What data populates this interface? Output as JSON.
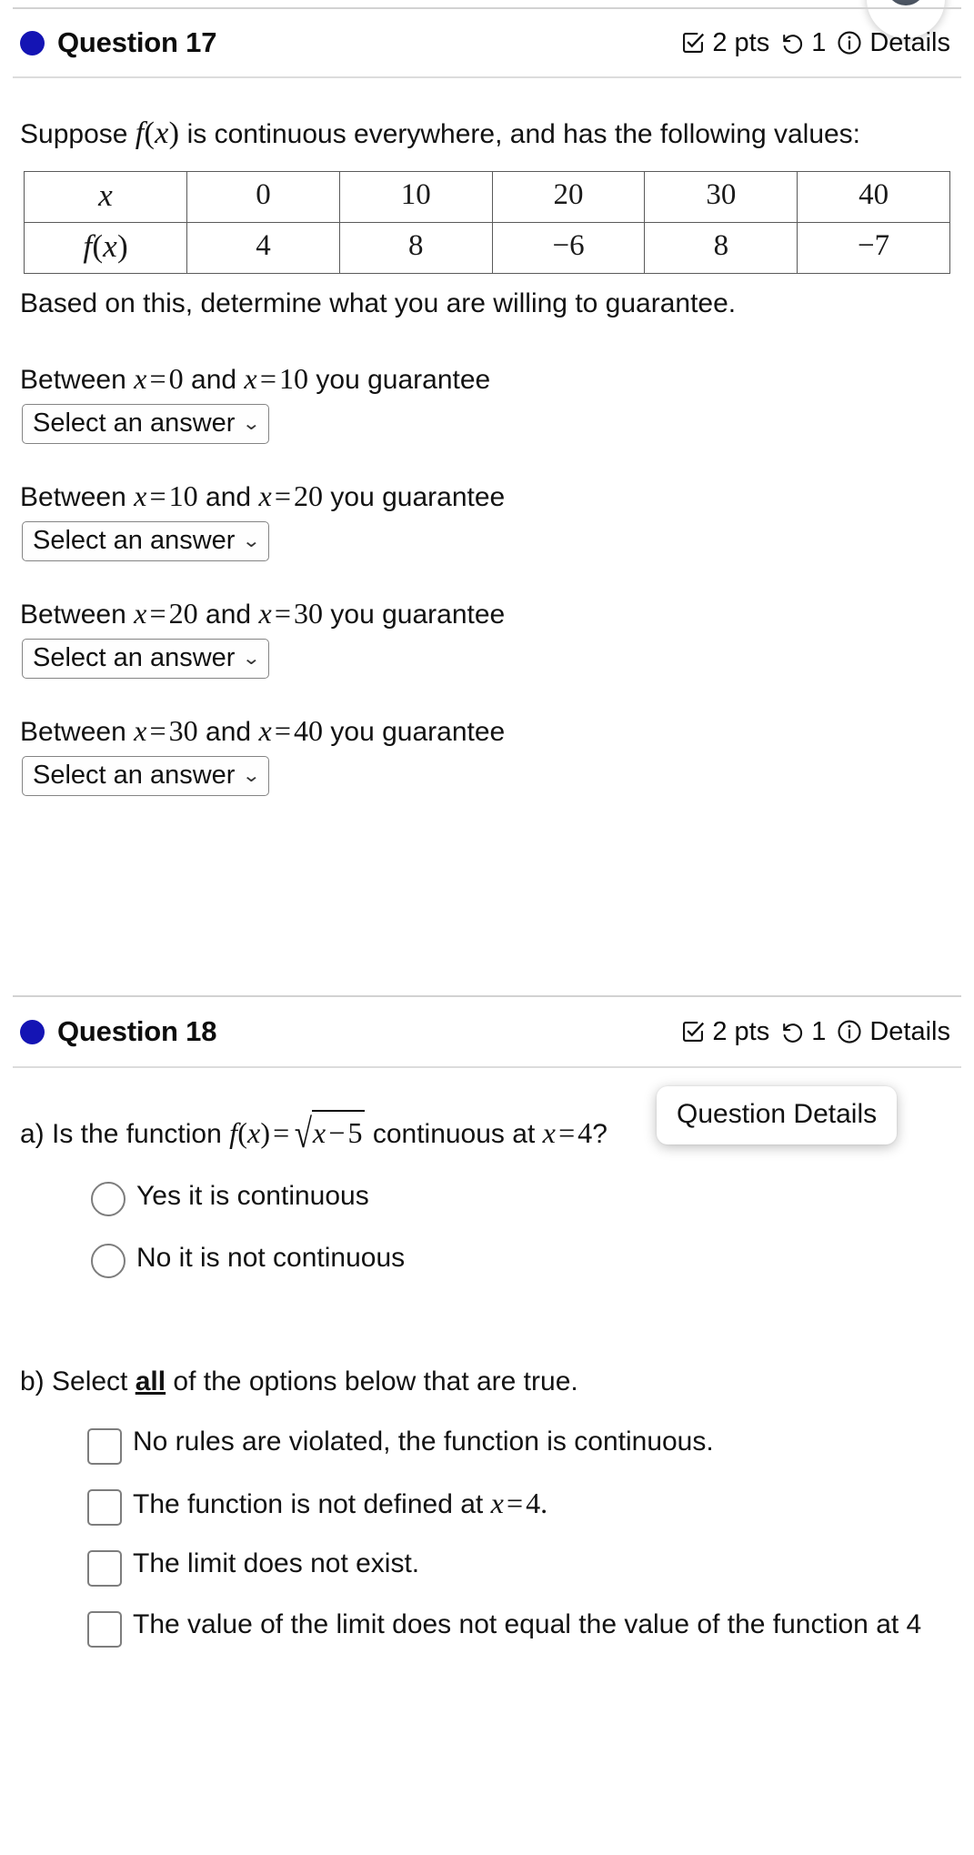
{
  "colors": {
    "question_dot": "#1414b4",
    "rule": "#d7d7d7",
    "control_border": "#848484"
  },
  "questions": [
    {
      "id": "q17",
      "dot_icon": "filled-circle-icon",
      "title": "Question 17",
      "meta": {
        "points_icon": "checkbox-check-icon",
        "points": "2 pts",
        "attempts_icon": "undo-arrow-icon",
        "attempts": "1",
        "details_icon": "info-circle-icon",
        "details_label": "Details"
      },
      "prompt_line1_pre": "Suppose ",
      "prompt_line1_math": "f(x)",
      "prompt_line1_post": " is continuous everywhere, and has the following values:",
      "table": {
        "row_labels": [
          "x",
          "f(x)"
        ],
        "x_values": [
          "0",
          "10",
          "20",
          "30",
          "40"
        ],
        "fx_values": [
          "4",
          "8",
          "−6",
          "8",
          "−7"
        ]
      },
      "prompt_line2": "Based on this, determine what you are willing to guarantee.",
      "intervals": [
        {
          "pre": "Between ",
          "left_var": "x",
          "left_eq": "=",
          "left_val": "0",
          "mid": " and ",
          "right_var": "x",
          "right_eq": "=",
          "right_val": "10",
          "post": " you guarantee",
          "select": {
            "value": "Select an answer",
            "chevron_icon": "chevron-down-icon"
          }
        },
        {
          "pre": "Between ",
          "left_var": "x",
          "left_eq": "=",
          "left_val": "10",
          "mid": "  and ",
          "right_var": "x",
          "right_eq": "=",
          "right_val": "20",
          "post": "  you guarantee",
          "select": {
            "value": "Select an answer",
            "chevron_icon": "chevron-down-icon"
          }
        },
        {
          "pre": "Between ",
          "left_var": "x",
          "left_eq": "=",
          "left_val": "20",
          "mid": "  and ",
          "right_var": "x",
          "right_eq": "=",
          "right_val": "30",
          "post": " you guarantee",
          "select": {
            "value": "Select an answer",
            "chevron_icon": "chevron-down-icon"
          }
        },
        {
          "pre": "Between ",
          "left_var": "x",
          "left_eq": "=",
          "left_val": "30",
          "mid": "  and ",
          "right_var": "x",
          "right_eq": "=",
          "right_val": "40",
          "post": "  you guarantee",
          "select": {
            "value": "Select an answer",
            "chevron_icon": "chevron-down-icon"
          }
        }
      ]
    },
    {
      "id": "q18",
      "dot_icon": "filled-circle-icon",
      "title": "Question 18",
      "meta": {
        "points_icon": "checkbox-check-icon",
        "points": "2 pts",
        "attempts_icon": "undo-arrow-icon",
        "attempts": "1",
        "details_icon": "info-circle-icon",
        "details_label": "Details"
      },
      "part_a": {
        "pre": "a) Is the function ",
        "func_lhs": "f(x)",
        "eq": "=",
        "radicand": "x − 5",
        "mid": " continuous at ",
        "at_var": "x",
        "at_eq": "=",
        "at_val": "4",
        "post": "?",
        "options": [
          {
            "label": "Yes it is continuous",
            "selected": false
          },
          {
            "label": "No it is not continuous",
            "selected": false
          }
        ]
      },
      "part_b": {
        "pre": "b) Select ",
        "emphasis": "all",
        "post": " of the options below that are true.",
        "options": [
          {
            "text": "No rules are violated, the function is continuous.",
            "checked": false,
            "math": null
          },
          {
            "text": "The function is not defined at ",
            "checked": false,
            "math": "x = 4."
          },
          {
            "text": "The limit does not exist.",
            "checked": false,
            "math": null
          },
          {
            "text": "The value of the limit does not equal the value of the function at 4",
            "checked": false,
            "math": null
          }
        ]
      }
    }
  ],
  "tooltip": {
    "text": "Question Details"
  }
}
